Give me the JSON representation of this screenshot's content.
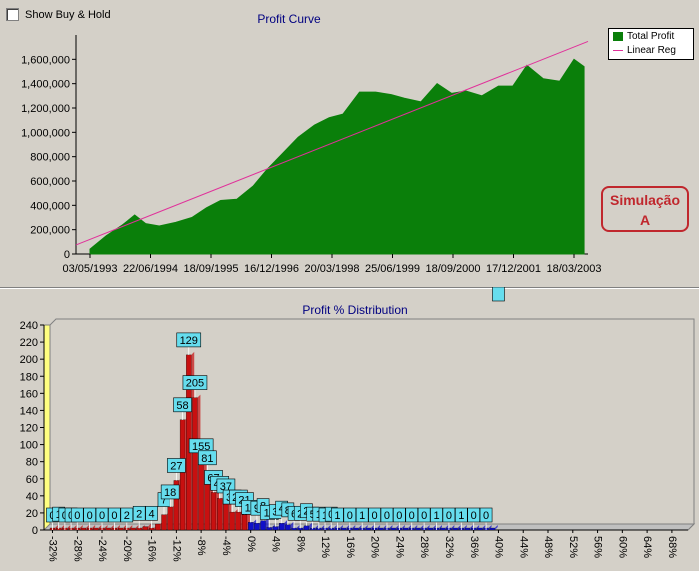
{
  "checkbox": {
    "label": "Show Buy & Hold",
    "checked": false
  },
  "annotation": {
    "line1": "Simulação",
    "line2": "A",
    "color": "#c0272d"
  },
  "colors": {
    "profit_fill": "#0a7f0a",
    "reg_line": "#e0309a",
    "loss_bar": "#c81010",
    "gain_bar": "#1010c8",
    "label_box": "#66ddee"
  },
  "chart_data": [
    {
      "type": "area",
      "title": "Profit Curve",
      "xlabel": "",
      "ylabel": "",
      "x_ticks": [
        "03/05/1993",
        "22/06/1994",
        "18/09/1995",
        "16/12/1996",
        "20/03/1998",
        "25/06/1999",
        "18/09/2000",
        "17/12/2001",
        "18/03/2003"
      ],
      "ylim": [
        0,
        1800000
      ],
      "y_ticks": [
        "0",
        "200,000",
        "400,000",
        "600,000",
        "800,000",
        "1,000,000",
        "1,200,000",
        "1,400,000",
        "1,600,000"
      ],
      "y_tick_values": [
        0,
        200000,
        400000,
        600000,
        800000,
        1000000,
        1200000,
        1400000,
        1600000
      ],
      "grid": false,
      "legend": {
        "placement": "top-right",
        "entries": [
          "Total Profit",
          "Linear Reg"
        ]
      },
      "series": [
        {
          "name": "Total Profit",
          "kind": "area",
          "x": [
            "03/05/1993",
            "01/09/1993",
            "01/01/1994",
            "01/04/1994",
            "22/06/1994",
            "01/10/1994",
            "01/02/1995",
            "01/06/1995",
            "18/09/1995",
            "01/01/1996",
            "01/05/1996",
            "01/09/1996",
            "16/12/1996",
            "01/04/1997",
            "01/08/1997",
            "01/12/1997",
            "20/03/1998",
            "01/07/1998",
            "01/11/1998",
            "01/03/1999",
            "25/06/1999",
            "01/10/1999",
            "01/02/2000",
            "01/06/2000",
            "18/09/2000",
            "01/01/2001",
            "01/05/2001",
            "01/09/2001",
            "17/12/2001",
            "01/04/2002",
            "01/08/2002",
            "01/12/2002",
            "18/03/2003",
            "01/06/2003"
          ],
          "y": [
            40000,
            150000,
            240000,
            320000,
            250000,
            230000,
            260000,
            300000,
            380000,
            440000,
            450000,
            560000,
            700000,
            820000,
            960000,
            1060000,
            1120000,
            1150000,
            1330000,
            1330000,
            1310000,
            1280000,
            1250000,
            1400000,
            1320000,
            1340000,
            1300000,
            1380000,
            1380000,
            1550000,
            1440000,
            1420000,
            1600000,
            1540000
          ]
        },
        {
          "name": "Linear Reg",
          "kind": "line",
          "x": [
            "03/05/1993",
            "01/06/2003"
          ],
          "y": [
            140000,
            1780000
          ]
        }
      ]
    },
    {
      "type": "bar",
      "title": "Profit % Distribution",
      "xlabel": "",
      "ylabel": "",
      "ylim": [
        0,
        240
      ],
      "y_ticks": [
        0,
        20,
        40,
        60,
        80,
        100,
        120,
        140,
        160,
        180,
        200,
        220,
        240
      ],
      "x_tick_labels": [
        "-32%",
        "-28%",
        "-24%",
        "-20%",
        "-16%",
        "-12%",
        "-8%",
        "-4%",
        "0%",
        "4%",
        "8%",
        "12%",
        "16%",
        "20%",
        "24%",
        "28%",
        "32%",
        "36%",
        "40%",
        "44%",
        "48%",
        "52%",
        "56%",
        "60%",
        "64%",
        "68%"
      ],
      "categories": [
        "-32%",
        "-31%",
        "-30%",
        "-29%",
        "-28%",
        "-27%",
        "-26%",
        "-25%",
        "-24%",
        "-23%",
        "-22%",
        "-21%",
        "-20%",
        "-19%",
        "-18%",
        "-17%",
        "-16%",
        "-15%",
        "-14%",
        "-13%",
        "-12%",
        "-11%",
        "-10%",
        "-9%",
        "-8%",
        "-7%",
        "-6%",
        "-5%",
        "-4%",
        "-3%",
        "-2%",
        "-1%",
        "0%",
        "1%",
        "2%",
        "3%",
        "4%",
        "5%",
        "6%",
        "7%",
        "8%",
        "9%",
        "10%",
        "11%",
        "12%",
        "13%",
        "14%",
        "15%",
        "16%",
        "17%",
        "18%",
        "19%",
        "20%",
        "21%",
        "22%",
        "23%",
        "24%",
        "25%",
        "26%",
        "27%",
        "28%",
        "29%",
        "30%",
        "31%",
        "32%",
        "33%",
        "34%",
        "35%",
        "36%",
        "37%",
        "38%",
        "39%",
        "40%",
        "41%",
        "42%",
        "43%",
        "44%",
        "45%",
        "46%",
        "47%",
        "48%",
        "49%",
        "50%",
        "51%",
        "52%",
        "53%",
        "54%",
        "55%",
        "56%",
        "57%",
        "58%",
        "59%",
        "60%",
        "61%",
        "62%",
        "63%",
        "64%",
        "65%",
        "66%",
        "67%",
        "68%",
        "69%",
        "70%"
      ],
      "values": [
        0,
        1,
        0,
        0,
        0,
        0,
        0,
        0,
        0,
        2,
        0,
        0,
        0,
        0,
        2,
        4,
        2,
        7,
        18,
        27,
        58,
        129,
        205,
        155,
        81,
        67,
        44,
        37,
        34,
        21,
        21,
        18,
        9,
        8,
        11,
        3,
        4,
        8,
        6,
        2,
        2,
        5,
        1,
        1,
        0,
        1,
        0,
        0,
        0,
        1,
        0,
        0,
        0,
        0,
        0,
        0,
        0,
        1,
        0,
        0,
        0,
        0,
        0,
        1,
        0,
        0,
        0,
        0,
        0,
        0,
        0,
        1
      ],
      "value_labels": [
        {
          "category": "-32%",
          "text": "0"
        },
        {
          "category": "-31%",
          "text": "1"
        },
        {
          "category": "-30%",
          "text": "0"
        },
        {
          "category": "-29%",
          "text": "0"
        },
        {
          "category": "-28%",
          "text": "0"
        },
        {
          "category": "-26%",
          "text": "0"
        },
        {
          "category": "-24%",
          "text": "0"
        },
        {
          "category": "-22%",
          "text": "0"
        },
        {
          "category": "-20%",
          "text": "2"
        },
        {
          "category": "-18%",
          "text": "2"
        },
        {
          "category": "-16%",
          "text": "4"
        },
        {
          "category": "-14%",
          "text": "7"
        },
        {
          "category": "-13%",
          "text": "18"
        },
        {
          "category": "-12%",
          "text": "27"
        },
        {
          "category": "-11%",
          "text": "58"
        },
        {
          "category": "-10%",
          "text": "129"
        },
        {
          "category": "-9%",
          "text": "205"
        },
        {
          "category": "-8%",
          "text": "155"
        },
        {
          "category": "-7%",
          "text": "81"
        },
        {
          "category": "-6%",
          "text": "67"
        },
        {
          "category": "-5%",
          "text": "44"
        },
        {
          "category": "-4%",
          "text": "37"
        },
        {
          "category": "-3%",
          "text": "34"
        },
        {
          "category": "-2%",
          "text": "21"
        },
        {
          "category": "-1%",
          "text": "21"
        },
        {
          "category": "0%",
          "text": "18"
        },
        {
          "category": "1%",
          "text": "9"
        },
        {
          "category": "2%",
          "text": "8"
        },
        {
          "category": "3%",
          "text": "11"
        },
        {
          "category": "4%",
          "text": "3"
        },
        {
          "category": "5%",
          "text": "4"
        },
        {
          "category": "6%",
          "text": "8"
        },
        {
          "category": "7%",
          "text": "6"
        },
        {
          "category": "8%",
          "text": "2"
        },
        {
          "category": "9%",
          "text": "2"
        },
        {
          "category": "10%",
          "text": "5"
        },
        {
          "category": "11%",
          "text": "1"
        },
        {
          "category": "12%",
          "text": "1"
        },
        {
          "category": "13%",
          "text": "0"
        },
        {
          "category": "14%",
          "text": "1"
        },
        {
          "category": "16%",
          "text": "0"
        },
        {
          "category": "18%",
          "text": "1"
        },
        {
          "category": "20%",
          "text": "0"
        },
        {
          "category": "22%",
          "text": "0"
        },
        {
          "category": "24%",
          "text": "0"
        },
        {
          "category": "26%",
          "text": "0"
        },
        {
          "category": "28%",
          "text": "0"
        },
        {
          "category": "30%",
          "text": "1"
        },
        {
          "category": "32%",
          "text": "0"
        },
        {
          "category": "34%",
          "text": "1"
        },
        {
          "category": "36%",
          "text": "0"
        },
        {
          "category": "38%",
          "text": "0"
        },
        {
          "category": "40%",
          "text": "1"
        }
      ],
      "grid": false
    }
  ]
}
